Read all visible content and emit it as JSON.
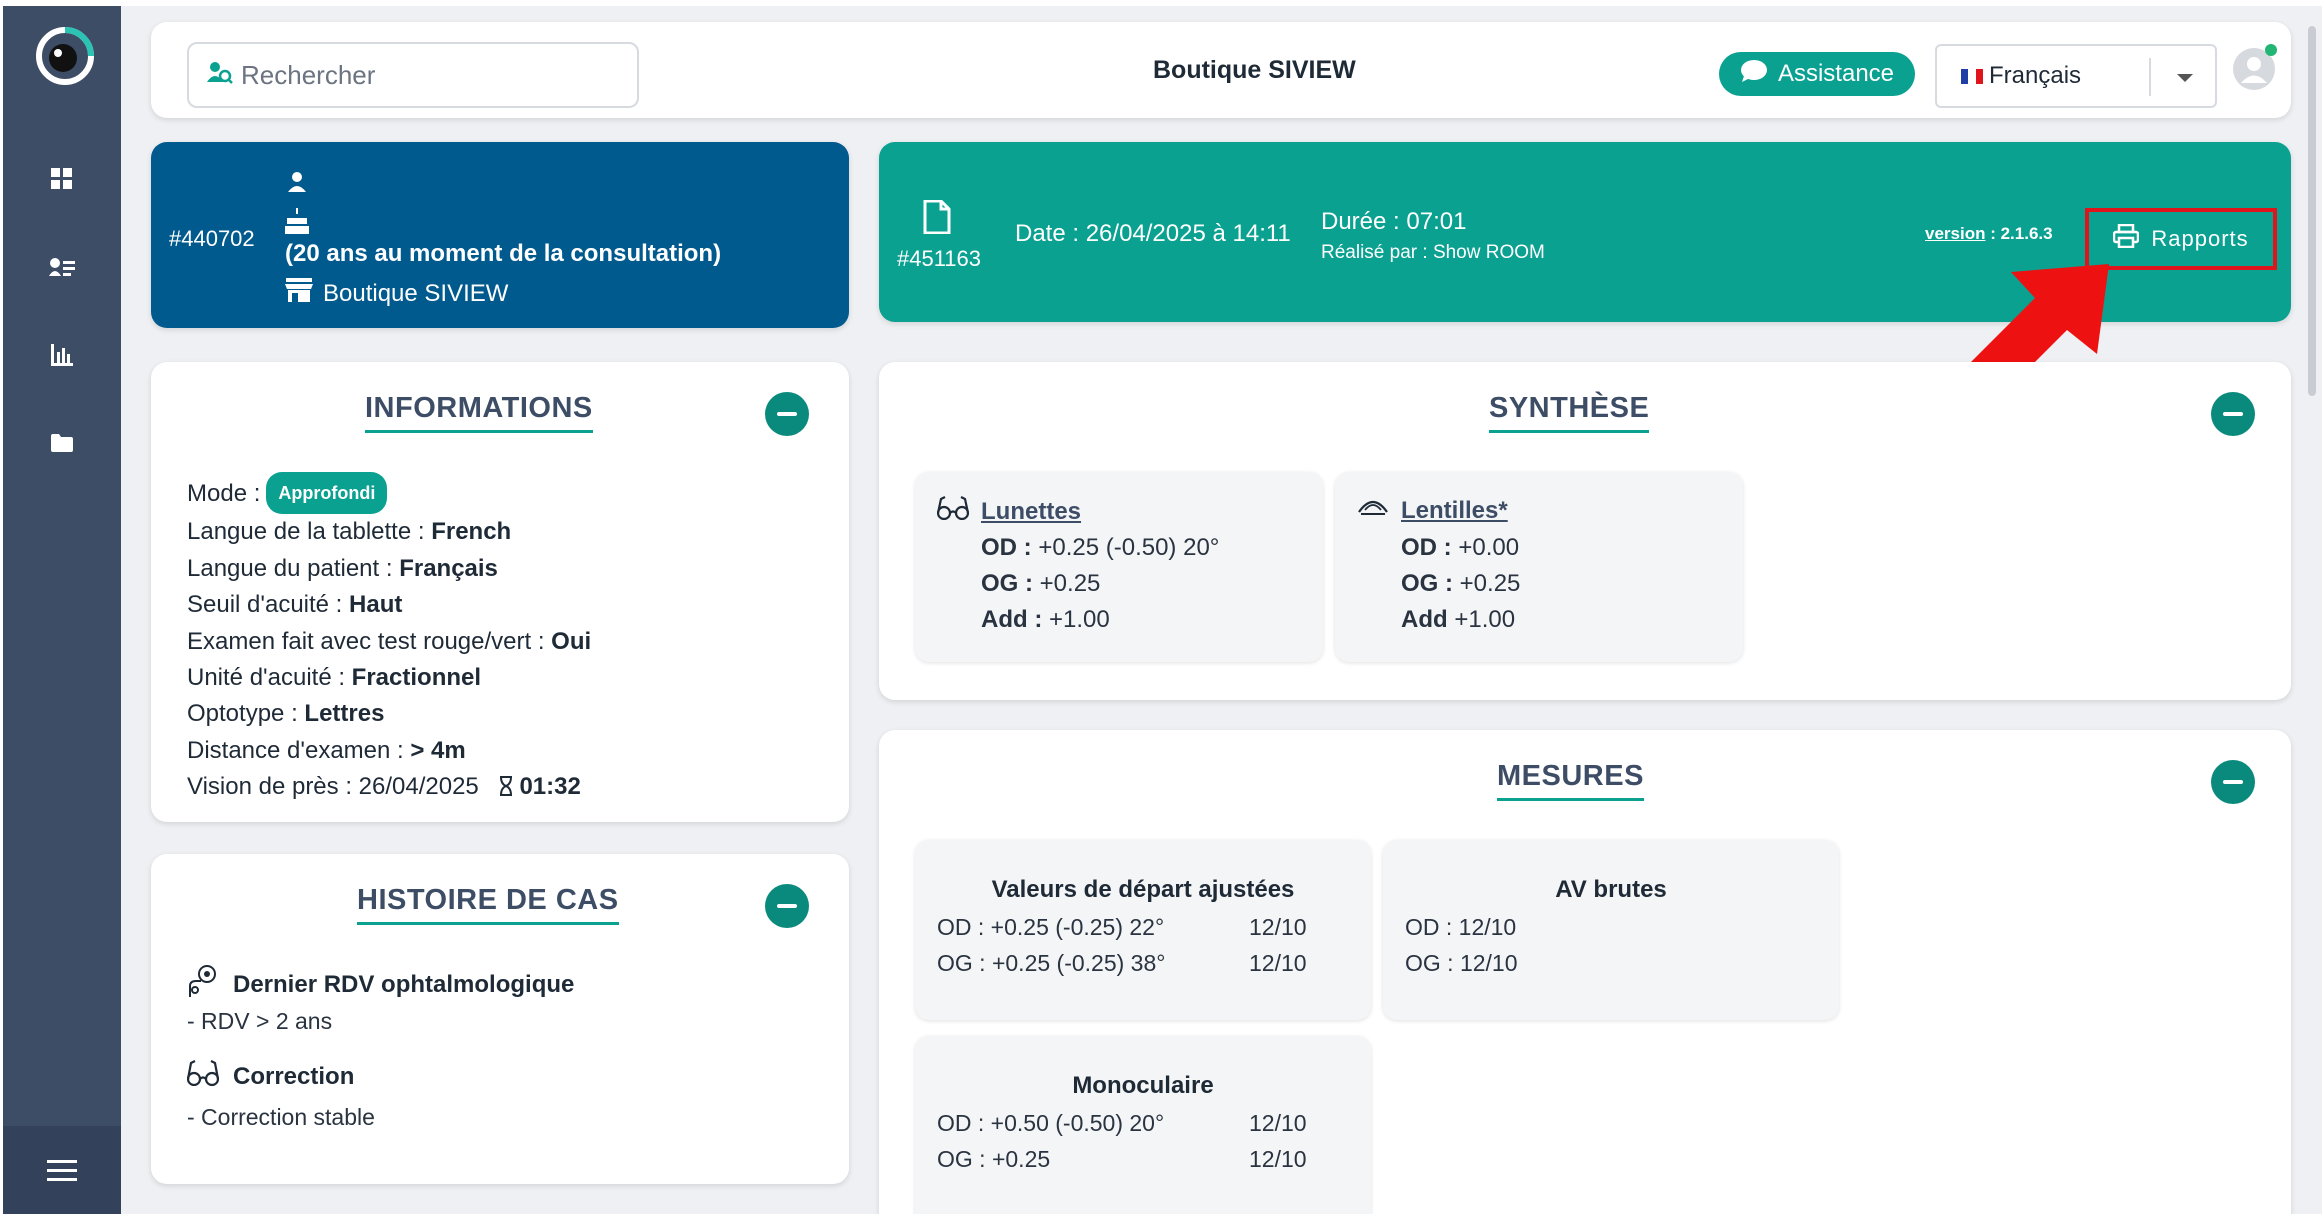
{
  "colors": {
    "sidebar": "#3d4d66",
    "teal": "#0aa191",
    "patient_blue": "#005a8e",
    "highlight_red": "#e0141b"
  },
  "sidebar": {
    "items": [
      {
        "icon": "dashboard-icon"
      },
      {
        "icon": "patients-list-icon"
      },
      {
        "icon": "statistics-icon"
      },
      {
        "icon": "folder-icon"
      }
    ],
    "menu_icon": "hamburger-menu-icon"
  },
  "topbar": {
    "search_placeholder": "Rechercher",
    "shop_title": "Boutique SIVIEW",
    "assistance_label": "Assistance",
    "language_selected": "Français"
  },
  "patient": {
    "id": "#440702",
    "age_note": "(20 ans au moment de la consultation)",
    "store": "Boutique SIVIEW"
  },
  "consultation": {
    "id": "#451163",
    "date": "Date : 26/04/2025 à 14:11",
    "duration": "Durée : 07:01",
    "performed_by": "Réalisé par : Show ROOM",
    "version_label": "version",
    "version_value": " : 2.1.6.3",
    "reports_label": "Rapports"
  },
  "informations": {
    "title": "INFORMATIONS",
    "mode_label": "Mode :",
    "mode_badge": "Approfondi",
    "rows": [
      {
        "label": "Langue de la tablette : ",
        "value": "French"
      },
      {
        "label": "Langue du patient : ",
        "value": "Français"
      },
      {
        "label": "Seuil d'acuité : ",
        "value": "Haut"
      },
      {
        "label": "Examen fait avec test rouge/vert : ",
        "value": "Oui"
      },
      {
        "label": "Unité d'acuité : ",
        "value": "Fractionnel"
      },
      {
        "label": "Optotype : ",
        "value": "Lettres"
      },
      {
        "label": "Distance d'examen : ",
        "value": "> 4m"
      }
    ],
    "near_vision_label": "Vision de près : 26/04/2025",
    "near_vision_time": "01:32"
  },
  "histoire": {
    "title": "HISTOIRE DE CAS",
    "items": [
      {
        "heading": "Dernier RDV ophtalmologique",
        "text": "- RDV > 2 ans"
      },
      {
        "heading": "Correction",
        "text": "- Correction stable"
      }
    ]
  },
  "synthese": {
    "title": "SYNTHÈSE",
    "lunettes": {
      "title": "Lunettes",
      "od_label": "OD :",
      "od": " +0.25 (-0.50) 20°",
      "og_label": "OG :",
      "og": " +0.25",
      "add_label": "Add :",
      "add": " +1.00"
    },
    "lentilles": {
      "title": "Lentilles*",
      "od_label": "OD :",
      "od": " +0.00",
      "og_label": "OG :",
      "og": " +0.25",
      "add_label": "Add",
      "add": " +1.00"
    }
  },
  "mesures": {
    "title": "MESURES",
    "valeurs": {
      "title": "Valeurs de départ ajustées",
      "od": "OD : +0.25 (-0.25) 22°",
      "od_av": "12/10",
      "og": "OG : +0.25 (-0.25) 38°",
      "og_av": "12/10"
    },
    "av_brutes": {
      "title": "AV brutes",
      "od": "OD : 12/10",
      "og": "OG : 12/10"
    },
    "monoculaire": {
      "title": "Monoculaire",
      "od": "OD : +0.50 (-0.50) 20°",
      "od_av": "12/10",
      "og": "OG : +0.25",
      "og_av": "12/10"
    }
  }
}
